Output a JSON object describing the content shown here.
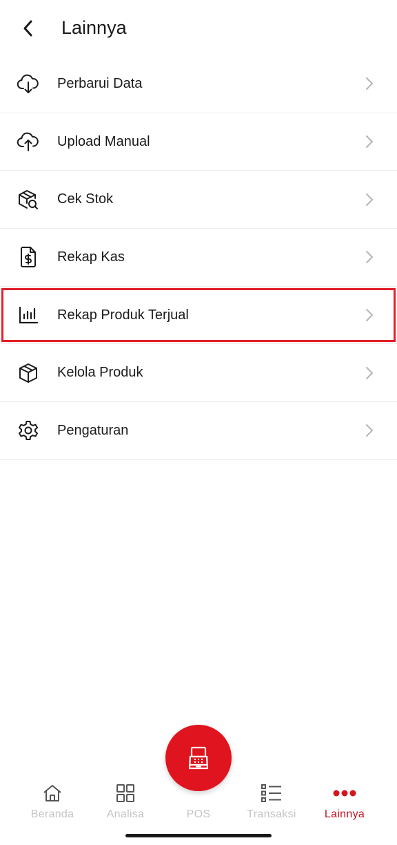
{
  "header": {
    "title": "Lainnya",
    "back_icon": "chevron-left-icon"
  },
  "menu": [
    {
      "label": "Perbarui Data",
      "icon": "cloud-download-icon"
    },
    {
      "label": "Upload Manual",
      "icon": "cloud-upload-icon"
    },
    {
      "label": "Cek Stok",
      "icon": "box-search-icon"
    },
    {
      "label": "Rekap Kas",
      "icon": "dollar-document-icon"
    },
    {
      "label": "Rekap Produk Terjual",
      "icon": "bar-chart-icon",
      "highlighted": true
    },
    {
      "label": "Kelola Produk",
      "icon": "box-icon"
    },
    {
      "label": "Pengaturan",
      "icon": "gear-icon"
    }
  ],
  "bottom_nav": [
    {
      "label": "Beranda",
      "icon": "home-icon"
    },
    {
      "label": "Analisa",
      "icon": "grid-icon"
    },
    {
      "label": "POS",
      "icon": "cash-register-icon"
    },
    {
      "label": "Transaksi",
      "icon": "list-icon"
    },
    {
      "label": "Lainnya",
      "icon": "more-dots-icon",
      "active": true
    }
  ],
  "colors": {
    "accent": "#e0141e",
    "active_label": "#c8101e",
    "inactive": "#c4c4c4",
    "highlight_border": "#e0202a"
  }
}
